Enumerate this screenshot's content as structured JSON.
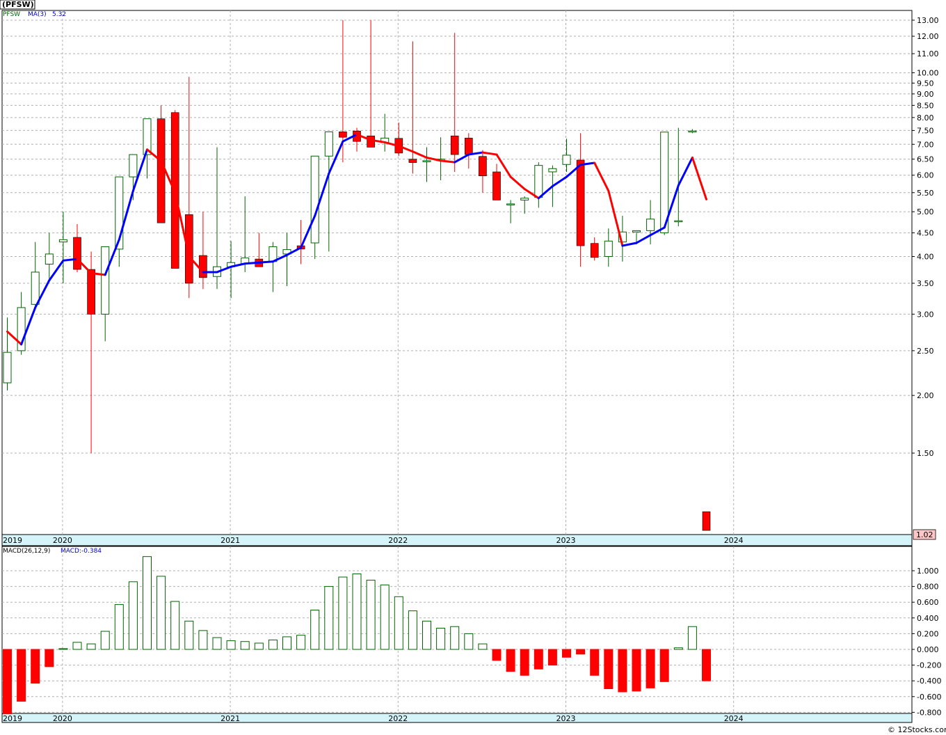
{
  "ticker_title": "(PFSW)",
  "price_panel": {
    "legend_symbol": "PFSW",
    "legend_ma": "MA(3)",
    "legend_ma_value": "5.32",
    "last_price_label": "1.02",
    "y_ticks": [
      "13.00",
      "12.00",
      "11.00",
      "10.00",
      "9.50",
      "9.00",
      "8.50",
      "8.00",
      "7.50",
      "7.00",
      "6.50",
      "6.00",
      "5.50",
      "5.00",
      "4.50",
      "4.00",
      "3.50",
      "3.00",
      "2.50",
      "2.00",
      "1.50"
    ]
  },
  "macd_panel": {
    "legend_label": "MACD(26,12,9)",
    "legend_value": "MACD:-0.384",
    "y_ticks": [
      "1.000",
      "0.800",
      "0.600",
      "0.400",
      "0.200",
      "0.000",
      "-0.200",
      "-0.400",
      "-0.600",
      "-0.800"
    ]
  },
  "x_axis_labels": [
    "2019",
    "2020",
    "2021",
    "2022",
    "2023",
    "2024"
  ],
  "watermark": "© 12Stocks.com",
  "colors": {
    "up": "#006400",
    "down": "#ff0000",
    "ma_up": "#0000ff",
    "ma_down": "#ff0000",
    "grid": "#b0b0b0",
    "axis_band": "#d4f4f9",
    "last_price_bg": "#ffc8c8",
    "legend_green": "#006400",
    "legend_blue": "#0000cc"
  },
  "chart_data": [
    {
      "type": "candlestick",
      "scale": "log",
      "interval": "monthly",
      "ylim": [
        1.0,
        13.7
      ],
      "x": [
        "2019-10",
        "2019-11",
        "2019-12",
        "2020-01",
        "2020-02",
        "2020-03",
        "2020-04",
        "2020-05",
        "2020-06",
        "2020-07",
        "2020-08",
        "2020-09",
        "2020-10",
        "2020-11",
        "2020-12",
        "2021-01",
        "2021-02",
        "2021-03",
        "2021-04",
        "2021-05",
        "2021-06",
        "2021-07",
        "2021-08",
        "2021-09",
        "2021-10",
        "2021-11",
        "2021-12",
        "2022-01",
        "2022-02",
        "2022-03",
        "2022-04",
        "2022-05",
        "2022-06",
        "2022-07",
        "2022-08",
        "2022-09",
        "2022-10",
        "2022-11",
        "2022-12",
        "2023-01",
        "2023-02",
        "2023-03",
        "2023-04",
        "2023-05",
        "2023-06",
        "2023-07",
        "2023-08",
        "2023-09",
        "2023-10",
        "2023-11",
        "2023-12"
      ],
      "open": [
        2.13,
        2.5,
        3.15,
        3.85,
        4.3,
        4.4,
        3.75,
        3.0,
        4.15,
        5.95,
        6.65,
        7.95,
        8.2,
        4.93,
        4.02,
        3.62,
        3.8,
        3.86,
        3.95,
        3.9,
        4.05,
        4.22,
        4.28,
        6.6,
        7.45,
        7.48,
        7.3,
        7.06,
        7.21,
        6.5,
        6.45,
        6.45,
        7.3,
        7.22,
        6.59,
        6.1,
        5.2,
        5.3,
        5.37,
        6.1,
        6.33,
        6.47,
        4.27,
        4.0,
        4.3,
        4.52,
        4.55,
        4.5,
        4.78,
        7.44,
        1.12
      ],
      "high": [
        2.95,
        3.35,
        4.3,
        4.5,
        5.0,
        4.7,
        4.1,
        3.9,
        4.5,
        6.4,
        7.2,
        8.5,
        8.3,
        9.8,
        5.0,
        6.9,
        4.32,
        5.4,
        4.5,
        4.3,
        4.5,
        4.8,
        5.0,
        7.3,
        13.0,
        7.6,
        13.0,
        8.15,
        7.8,
        11.7,
        6.9,
        7.25,
        12.2,
        7.4,
        6.8,
        6.35,
        5.3,
        5.4,
        6.4,
        6.3,
        7.2,
        7.4,
        4.4,
        4.6,
        4.9,
        4.5,
        5.3,
        4.8,
        7.6,
        7.55,
        1.12
      ],
      "low": [
        2.05,
        2.45,
        3.1,
        3.55,
        3.5,
        3.7,
        1.5,
        2.62,
        3.8,
        5.3,
        5.9,
        6.7,
        4.2,
        3.25,
        3.4,
        3.4,
        3.25,
        3.7,
        3.85,
        3.35,
        3.45,
        3.85,
        3.95,
        4.1,
        6.4,
        6.75,
        6.9,
        6.75,
        6.6,
        6.05,
        5.8,
        5.85,
        6.1,
        6.2,
        5.5,
        5.3,
        4.72,
        4.95,
        5.1,
        5.12,
        6.1,
        3.8,
        3.92,
        3.8,
        3.9,
        4.25,
        4.25,
        4.45,
        4.65,
        7.4,
        1.05
      ],
      "close": [
        2.48,
        3.1,
        3.7,
        4.05,
        4.35,
        3.75,
        3.0,
        4.2,
        5.95,
        6.65,
        7.95,
        4.73,
        3.77,
        3.5,
        3.6,
        3.8,
        3.88,
        3.97,
        3.8,
        4.2,
        4.14,
        4.15,
        6.6,
        7.45,
        7.25,
        7.1,
        6.9,
        7.22,
        6.7,
        6.39,
        6.45,
        6.5,
        6.65,
        6.65,
        5.98,
        5.3,
        5.2,
        5.35,
        6.3,
        6.2,
        6.63,
        4.22,
        3.98,
        4.32,
        4.52,
        4.55,
        4.82,
        7.44,
        4.78,
        7.48,
        1.02
      ]
    },
    {
      "type": "line",
      "name": "MA(3)",
      "x": [
        "2019-10",
        "2019-11",
        "2019-12",
        "2020-01",
        "2020-02",
        "2020-03",
        "2020-04",
        "2020-05",
        "2020-06",
        "2020-07",
        "2020-08",
        "2020-09",
        "2020-10",
        "2020-11",
        "2020-12",
        "2021-01",
        "2021-02",
        "2021-03",
        "2021-04",
        "2021-05",
        "2021-06",
        "2021-07",
        "2021-08",
        "2021-09",
        "2021-10",
        "2021-11",
        "2021-12",
        "2022-01",
        "2022-02",
        "2022-03",
        "2022-04",
        "2022-05",
        "2022-06",
        "2022-07",
        "2022-08",
        "2022-09",
        "2022-10",
        "2022-11",
        "2022-12",
        "2023-01",
        "2023-02",
        "2023-03",
        "2023-04",
        "2023-05",
        "2023-06",
        "2023-07",
        "2023-08",
        "2023-09",
        "2023-10",
        "2023-11",
        "2023-12"
      ],
      "values": [
        2.75,
        2.58,
        3.1,
        3.55,
        3.92,
        3.95,
        3.68,
        3.65,
        4.35,
        5.55,
        6.82,
        6.44,
        5.5,
        4.0,
        3.7,
        3.7,
        3.8,
        3.86,
        3.88,
        3.9,
        4.03,
        4.18,
        4.9,
        6.05,
        7.1,
        7.35,
        7.15,
        7.07,
        6.94,
        6.75,
        6.55,
        6.45,
        6.4,
        6.65,
        6.72,
        6.65,
        5.95,
        5.6,
        5.35,
        5.68,
        5.95,
        6.32,
        6.38,
        5.55,
        4.22,
        4.28,
        4.45,
        4.62,
        5.7,
        6.55,
        5.32
      ]
    },
    {
      "type": "bar",
      "name": "MACD(26,12,9)",
      "ylim": [
        -0.82,
        1.2
      ],
      "x": [
        "2019-10",
        "2019-11",
        "2019-12",
        "2020-01",
        "2020-02",
        "2020-03",
        "2020-04",
        "2020-05",
        "2020-06",
        "2020-07",
        "2020-08",
        "2020-09",
        "2020-10",
        "2020-11",
        "2020-12",
        "2021-01",
        "2021-02",
        "2021-03",
        "2021-04",
        "2021-05",
        "2021-06",
        "2021-07",
        "2021-08",
        "2021-09",
        "2021-10",
        "2021-11",
        "2021-12",
        "2022-01",
        "2022-02",
        "2022-03",
        "2022-04",
        "2022-05",
        "2022-06",
        "2022-07",
        "2022-08",
        "2022-09",
        "2022-10",
        "2022-11",
        "2022-12",
        "2023-01",
        "2023-02",
        "2023-03",
        "2023-04",
        "2023-05",
        "2023-06",
        "2023-07",
        "2023-08",
        "2023-09",
        "2023-10",
        "2023-11",
        "2023-12"
      ],
      "values": [
        -0.82,
        -0.66,
        -0.43,
        -0.22,
        0.01,
        0.09,
        0.07,
        0.23,
        0.57,
        0.86,
        1.18,
        0.93,
        0.61,
        0.36,
        0.24,
        0.15,
        0.11,
        0.1,
        0.08,
        0.12,
        0.16,
        0.18,
        0.5,
        0.8,
        0.92,
        0.96,
        0.88,
        0.82,
        0.67,
        0.49,
        0.36,
        0.27,
        0.29,
        0.2,
        0.07,
        -0.14,
        -0.28,
        -0.33,
        -0.25,
        -0.2,
        -0.1,
        -0.06,
        -0.33,
        -0.5,
        -0.54,
        -0.53,
        -0.49,
        -0.41,
        0.02,
        0.29,
        -0.4
      ]
    }
  ]
}
